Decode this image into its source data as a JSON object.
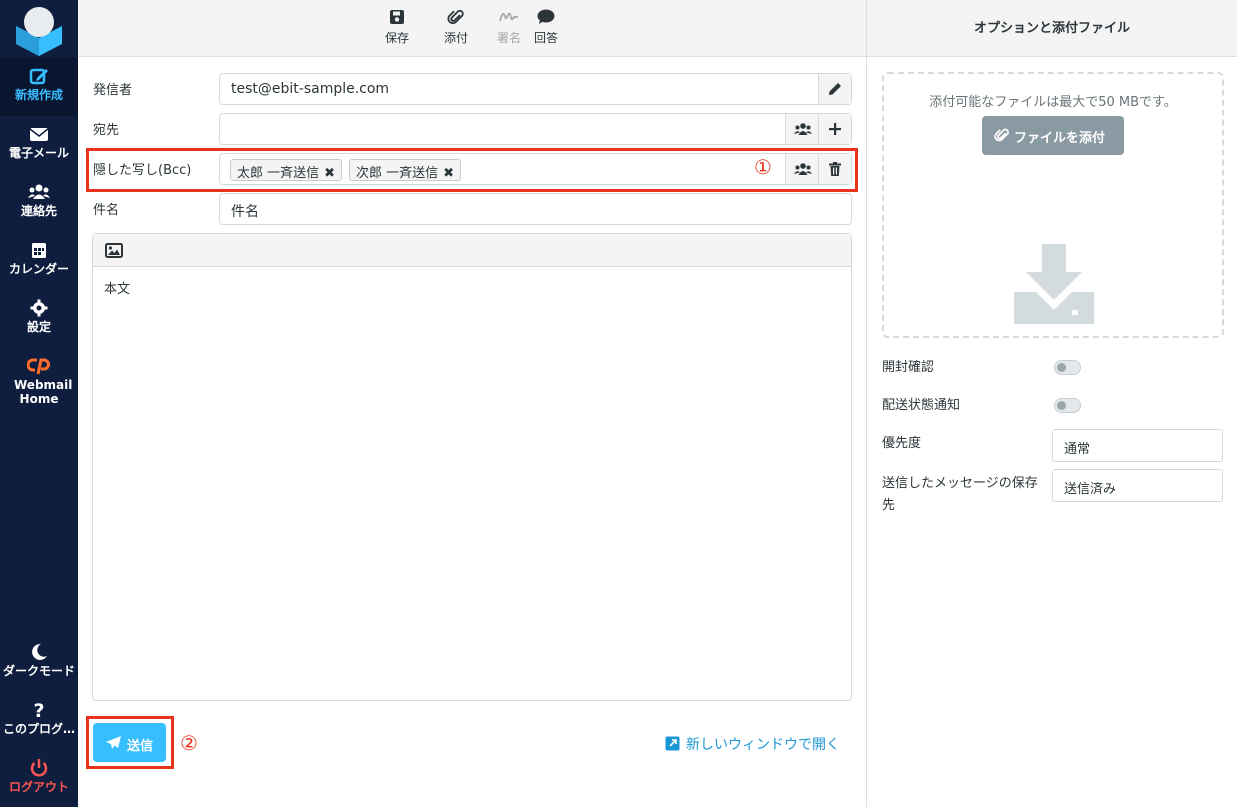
{
  "sidebar": {
    "items": [
      {
        "label": "新規作成",
        "icon": "compose-icon"
      },
      {
        "label": "電子メール",
        "icon": "envelope-icon"
      },
      {
        "label": "連絡先",
        "icon": "users-icon"
      },
      {
        "label": "カレンダー",
        "icon": "calendar-icon"
      },
      {
        "label": "設定",
        "icon": "gear-icon"
      },
      {
        "label": "Webmail Home",
        "icon": "cpanel-icon"
      }
    ],
    "bottom": [
      {
        "label": "ダークモード",
        "icon": "moon-icon"
      },
      {
        "label": "このプログ…",
        "icon": "question-icon"
      },
      {
        "label": "ログアウト",
        "icon": "power-icon"
      }
    ],
    "colors": {
      "bg": "#0f1e3e",
      "active": "#37beff",
      "logout": "#ff5552"
    }
  },
  "toolbar": {
    "save": "保存",
    "attach": "添付",
    "signature": "署名",
    "responses": "回答"
  },
  "form": {
    "from_label": "発信者",
    "from_value": "test@ebit-sample.com",
    "to_label": "宛先",
    "bcc_label": "隠した写し(Bcc)",
    "bcc_recipients": [
      "太郎 一斉送信",
      "次郎 一斉送信"
    ],
    "subject_label": "件名",
    "subject_placeholder": "件名",
    "body_placeholder": "本文",
    "marker_1": "①",
    "marker_2": "②"
  },
  "actions": {
    "send": "送信",
    "new_window": "新しいウィンドウで開く"
  },
  "right_panel": {
    "title": "オプションと添付ファイル",
    "attach_hint": "添付可能なファイルは最大で50 MBです。",
    "attach_button": "ファイルを添付",
    "read_receipt": "開封確認",
    "delivery_status": "配送状態通知",
    "priority_label": "優先度",
    "priority_value": "通常",
    "save_sent_label": "送信したメッセージの保存先",
    "save_sent_value": "送信済み"
  },
  "accent": "#37beff",
  "highlight": "#e8341c"
}
